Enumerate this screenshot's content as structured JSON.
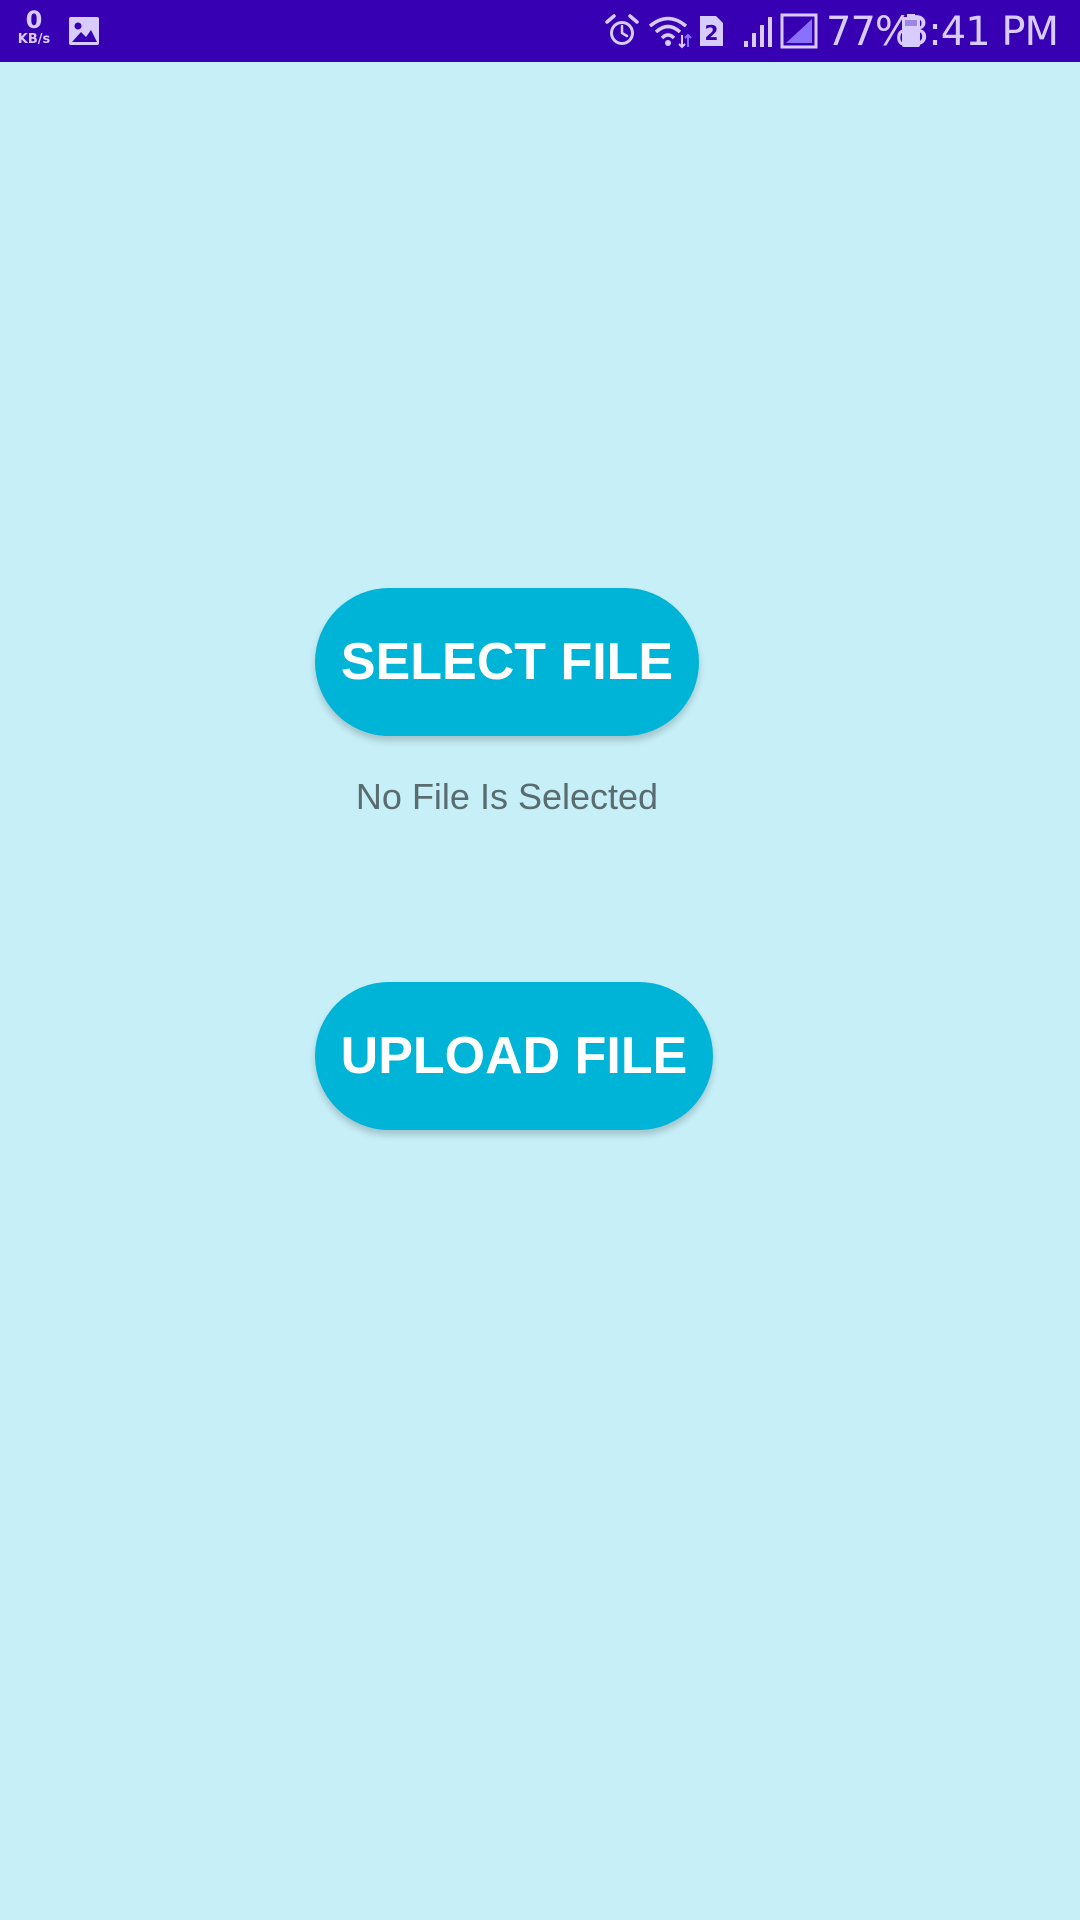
{
  "status_bar": {
    "net_speed_value": "0",
    "net_speed_unit": "KB/s",
    "sim_slot": "2",
    "battery_percent": "77%",
    "time": "3:41 PM",
    "background_color": "#3700b3",
    "icons": [
      "gallery-icon",
      "alarm-icon",
      "wifi-icon",
      "sim-icon",
      "signal-icon",
      "battery-icon"
    ]
  },
  "main": {
    "select_button_label": "SELECT FILE",
    "file_status_text": "No File Is Selected",
    "upload_button_label": "UPLOAD FILE",
    "background_color": "#c6eff8",
    "accent_color": "#00b4d8"
  }
}
